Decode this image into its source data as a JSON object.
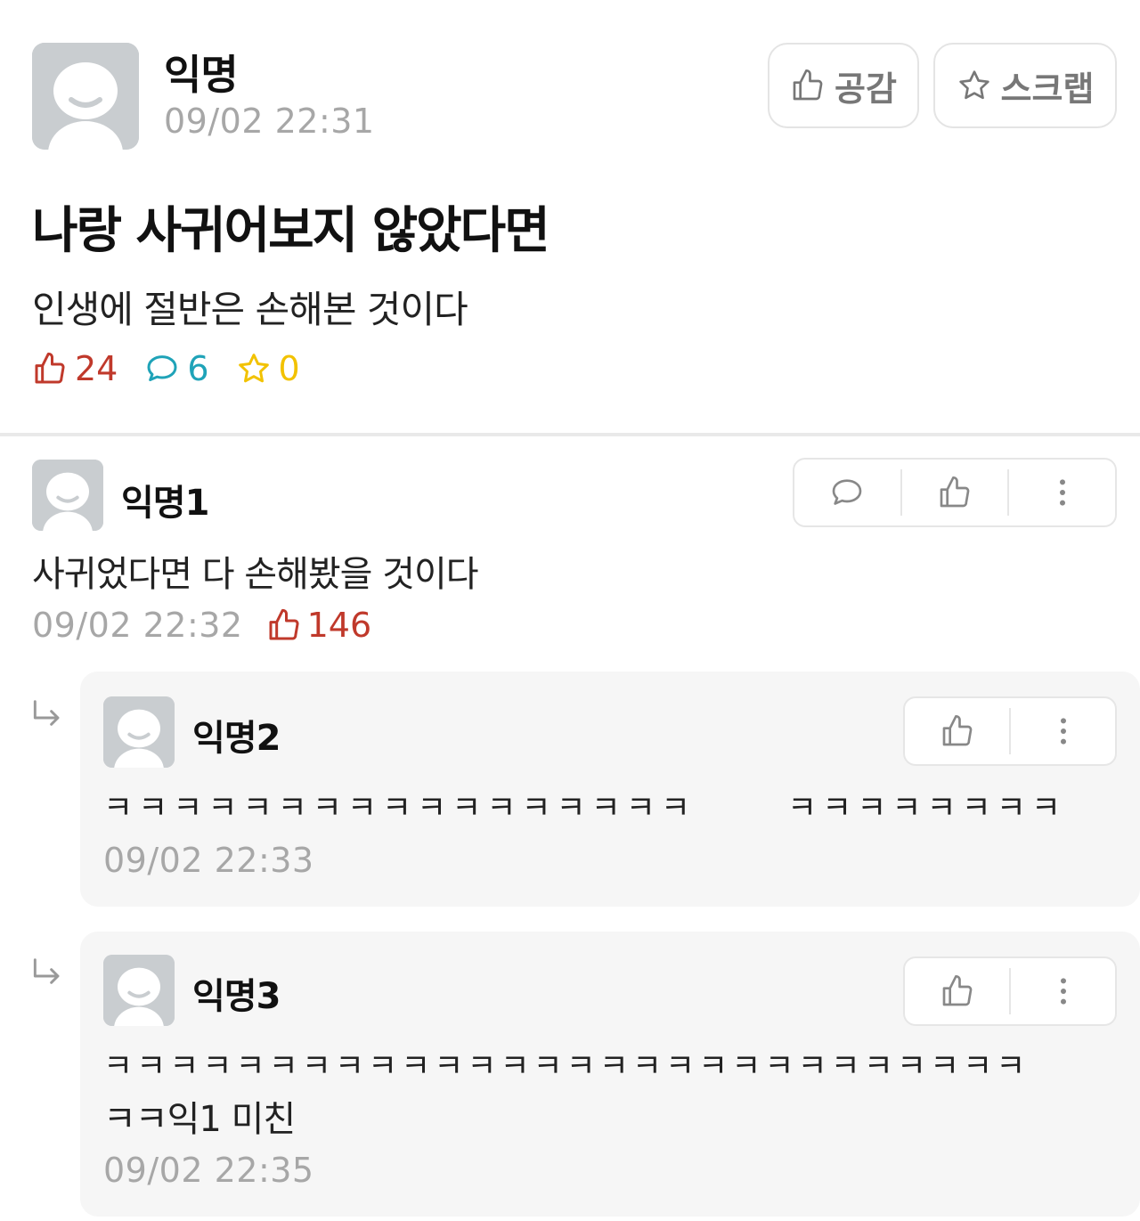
{
  "post": {
    "author": "익명",
    "time": "09/02 22:31",
    "title": "나랑 사귀어보지 않았다면",
    "body": "인생에 절반은 손해본 것이다",
    "like_button": "공감",
    "scrap_button": "스크랩",
    "stats": {
      "likes": "24",
      "comments": "6",
      "scraps": "0"
    }
  },
  "comments": [
    {
      "author": "익명1",
      "text": "사귀었다면 다 손해봤을 것이다",
      "time": "09/02 22:32",
      "likes": "146"
    }
  ],
  "replies": [
    {
      "author": "익명2",
      "text_part1": "ㅋㅋㅋㅋㅋㅋㅋㅋㅋㅋㅋㅋㅋㅋㅋㅋㅋ",
      "text_part2": "ㅋㅋㅋㅋㅋㅋㅋㅋ",
      "time": "09/02 22:33"
    },
    {
      "author": "익명3",
      "text_line1": "ㅋㅋㅋㅋㅋㅋㅋㅋㅋㅋㅋㅋㅋㅋㅋㅋㅋㅋㅋㅋㅋㅋㅋㅋㅋㅋㅋㅋ",
      "text_line2": "ㅋㅋ익1 미친",
      "time": "09/02 22:35"
    }
  ],
  "colors": {
    "like_red": "#c0392b",
    "comment_teal": "#1fa3b8",
    "scrap_yellow": "#f2c200",
    "muted": "#a7a7a7"
  },
  "icons": [
    "thumbs-up-icon",
    "star-icon",
    "speech-bubble-icon",
    "more-vertical-icon",
    "reply-arrow-icon",
    "default-avatar-icon"
  ]
}
